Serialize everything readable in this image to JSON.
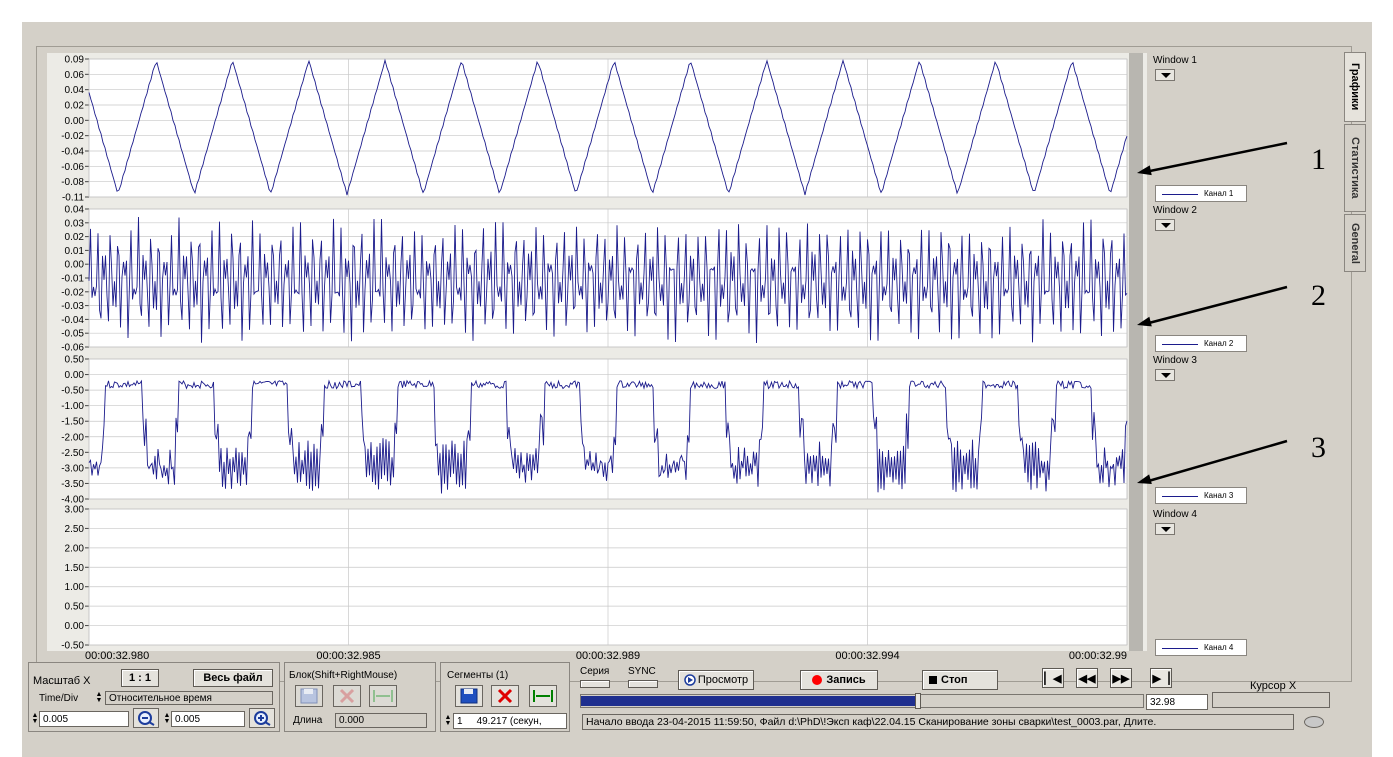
{
  "windows": [
    {
      "label": "Window 1",
      "legend": "Канал 1",
      "yticks": [
        "0.09",
        "0.06",
        "0.04",
        "0.02",
        "0.00",
        "-0.02",
        "-0.04",
        "-0.06",
        "-0.08",
        "-0.11"
      ],
      "yrange": [
        -0.11,
        0.09
      ],
      "signal": "triangle",
      "color": "#1c1c8c"
    },
    {
      "label": "Window 2",
      "legend": "Канал 2",
      "yticks": [
        "0.04",
        "0.03",
        "0.02",
        "0.01",
        "0.00",
        "-0.01",
        "-0.02",
        "-0.03",
        "-0.04",
        "-0.05",
        "-0.06"
      ],
      "yrange": [
        -0.06,
        0.04
      ],
      "signal": "dense-oscillation",
      "color": "#1c1c8c"
    },
    {
      "label": "Window 3",
      "legend": "Канал 3",
      "yticks": [
        "0.50",
        "0.00",
        "-0.50",
        "-1.00",
        "-1.50",
        "-2.00",
        "-2.50",
        "-3.00",
        "-3.50",
        "-4.00"
      ],
      "yrange": [
        -4.0,
        0.5
      ],
      "signal": "dips",
      "color": "#1c1c8c"
    },
    {
      "label": "Window 4",
      "legend": "Канал 4",
      "yticks": [
        "3.00",
        "2.50",
        "2.00",
        "1.50",
        "1.00",
        "0.50",
        "0.00",
        "-0.50"
      ],
      "yrange": [
        -0.5,
        3.0
      ],
      "signal": "none",
      "color": "#1c1c8c"
    }
  ],
  "xticks": [
    "00:00:32.980",
    "00:00:32.985",
    "00:00:32.989",
    "00:00:32.994",
    "00:00:32.99"
  ],
  "tabs": [
    "Графики",
    "Статистика",
    "General"
  ],
  "annotations": [
    "1",
    "2",
    "3"
  ],
  "scale": {
    "title": "Масштаб X",
    "ratio_button": "1 : 1",
    "whole_file_button": "Весь файл",
    "time_div_label": "Time/Div",
    "time_mode": "Относительное время",
    "value1": "0.005",
    "value2": "0.005"
  },
  "block": {
    "title": "Блок(Shift+RightMouse)",
    "length_label": "Длина",
    "length_value": "0.000"
  },
  "segments": {
    "title": "Сегменты (1)",
    "index": "1",
    "duration": "49.217 (секун,"
  },
  "playback": {
    "series_label": "Серия",
    "sync_label": "SYNC",
    "view_button": "Просмотр",
    "record_button": "Запись",
    "stop_button": "Стоп",
    "position_value": "32.98",
    "progress": 0.6,
    "cursor_label": "Курсор X",
    "cursor_value": "",
    "status_text": "Начало ввода  23-04-2015 11:59:50, Файл d:\\PhD\\!Эксп каф\\22.04.15 Сканирование зоны сварки\\test_0003.par, Длите."
  },
  "colors": {
    "panel": "#d4d0c8",
    "trace": "#1c1c8c",
    "record": "#ff0000",
    "progress": "#1f2f8f"
  },
  "icons": [
    "save-icon",
    "delete-icon",
    "expand-icon",
    "zoom-out-icon",
    "zoom-in-icon",
    "first-icon",
    "rewind-icon",
    "fast-forward-icon",
    "last-icon",
    "led-icon"
  ]
}
